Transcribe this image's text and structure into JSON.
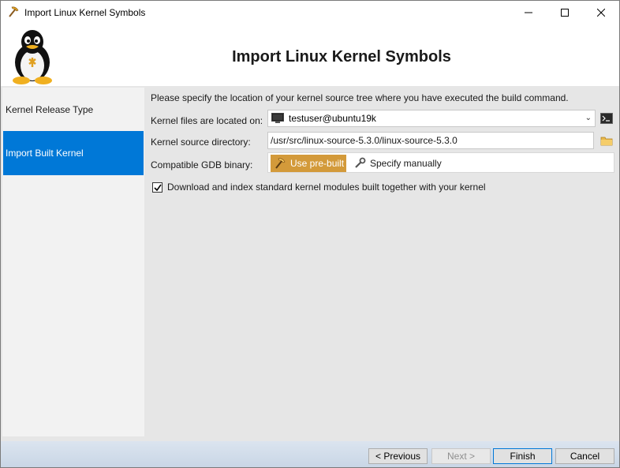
{
  "window": {
    "title": "Import Linux Kernel Symbols",
    "icons": {
      "app": "pickaxe-icon",
      "minimize": "minimize-icon",
      "maximize": "maximize-icon",
      "close": "close-icon"
    }
  },
  "header": {
    "title": "Import Linux Kernel Symbols",
    "logo": "tux-penguin-logo"
  },
  "sidebar": {
    "items": [
      {
        "label": "Kernel Release Type",
        "selected": false
      },
      {
        "label": "Import Built Kernel",
        "selected": true
      }
    ],
    "accent": "#0078d7"
  },
  "main": {
    "intro": "Please specify the location of your kernel source tree where you have executed the build command.",
    "location_label": "Kernel files are located on:",
    "location_value": "testuser@ubuntu19k",
    "source_label": "Kernel source directory:",
    "source_value": "/usr/src/linux-source-5.3.0/linux-source-5.3.0",
    "gdb_label": "Compatible GDB binary:",
    "gdb_options": [
      "Use pre-built",
      "Specify manually"
    ],
    "gdb_selected": "Use pre-built",
    "gdb_selected_color": "#d39a3a",
    "checkbox_label": "Download and index standard kernel modules built together with your kernel",
    "checkbox_checked": true
  },
  "footer": {
    "previous": "< Previous",
    "next": "Next >",
    "finish": "Finish",
    "cancel": "Cancel"
  }
}
